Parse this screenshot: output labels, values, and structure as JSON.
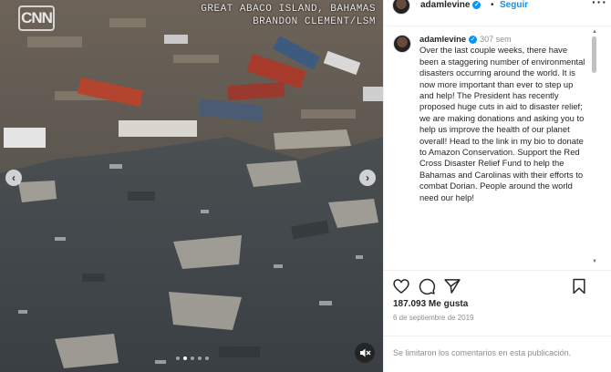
{
  "media": {
    "logo_text": "CNN",
    "caption_line1": "GREAT ABACO ISLAND, BAHAMAS",
    "caption_line2": "BRANDON CLEMENT/LSM",
    "prev_glyph": "‹",
    "next_glyph": "›",
    "carousel_dots": 5,
    "active_dot": 1
  },
  "post_header": {
    "username": "adamlevine",
    "separator": "•",
    "follow_label": "Seguir",
    "more_glyph": "···"
  },
  "caption": {
    "username": "adamlevine",
    "time": "307 sem",
    "text": "Over the last couple weeks, there have been a staggering number of environmental disasters occurring around the world. It is now more important than ever to step up and help! The President has recently proposed huge cuts in aid to disaster relief; we are making donations and asking you to help us improve the health of our planet overall! Head to the link in my bio to donate to Amazon Conservation. Support the Red Cross Disaster Relief Fund to help the Bahamas and Carolinas with their efforts to combat Dorian. People around the world need our help!"
  },
  "load_more_glyph": "+",
  "stats": {
    "likes": "187.093 Me gusta",
    "date": "6 de septiembre de 2019"
  },
  "comments_disabled": "Se limitaron los comentarios en esta publicación.",
  "icons": [
    "heart-icon",
    "comment-icon",
    "share-icon",
    "bookmark-icon",
    "mute-icon",
    "verified-icon"
  ],
  "colors": {
    "accent": "#0095f6",
    "text": "#262626",
    "muted": "#8e8e8e"
  }
}
